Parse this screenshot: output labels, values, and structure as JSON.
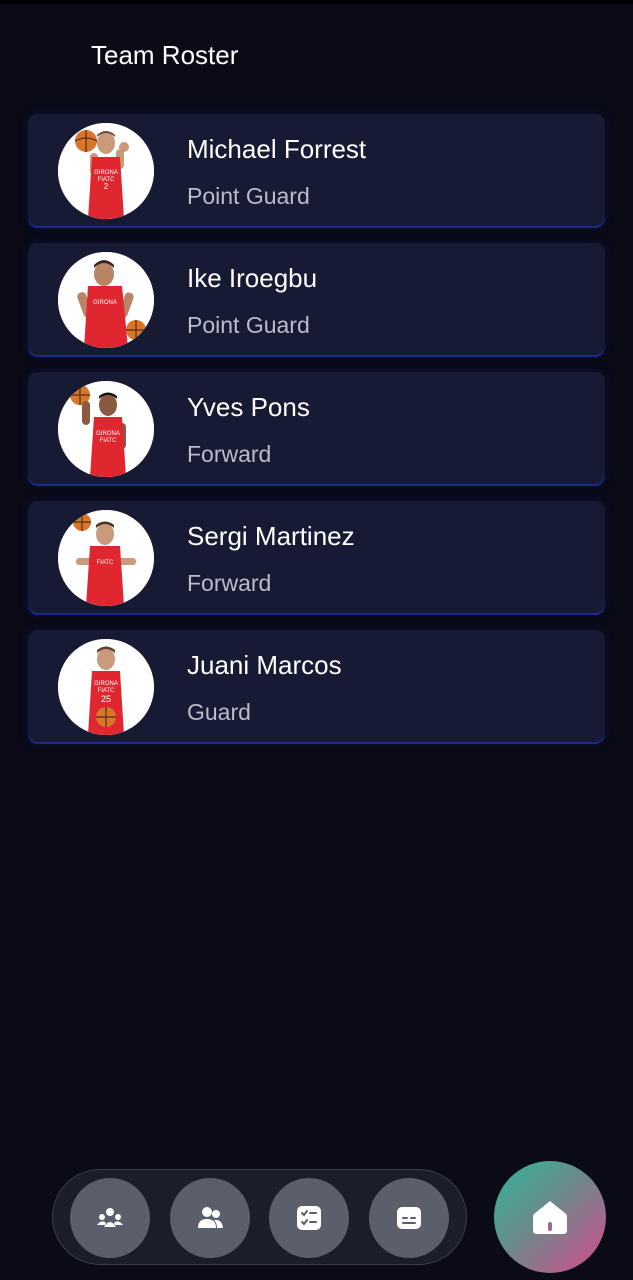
{
  "header": {
    "title": "Team Roster"
  },
  "players": [
    {
      "name": "Michael Forrest",
      "position": "Point Guard",
      "jersey_number": "2"
    },
    {
      "name": "Ike Iroegbu",
      "position": "Point Guard",
      "jersey_number": ""
    },
    {
      "name": "Yves Pons",
      "position": "Forward",
      "jersey_number": ""
    },
    {
      "name": "Sergi Martinez",
      "position": "Forward",
      "jersey_number": ""
    },
    {
      "name": "Juani Marcos",
      "position": "Guard",
      "jersey_number": "25"
    }
  ],
  "bottom_nav": {
    "buttons": [
      {
        "icon": "team-icon"
      },
      {
        "icon": "users-icon"
      },
      {
        "icon": "checklist-icon"
      },
      {
        "icon": "card-icon"
      }
    ],
    "home_button": {
      "icon": "home-icon"
    }
  },
  "colors": {
    "background": "#0a0b17",
    "card": "#161a33",
    "card_border": "#1b2b8a",
    "position_text": "#b8bccb",
    "nav_button": "#5b5e6b",
    "jersey": "#e0262f"
  }
}
